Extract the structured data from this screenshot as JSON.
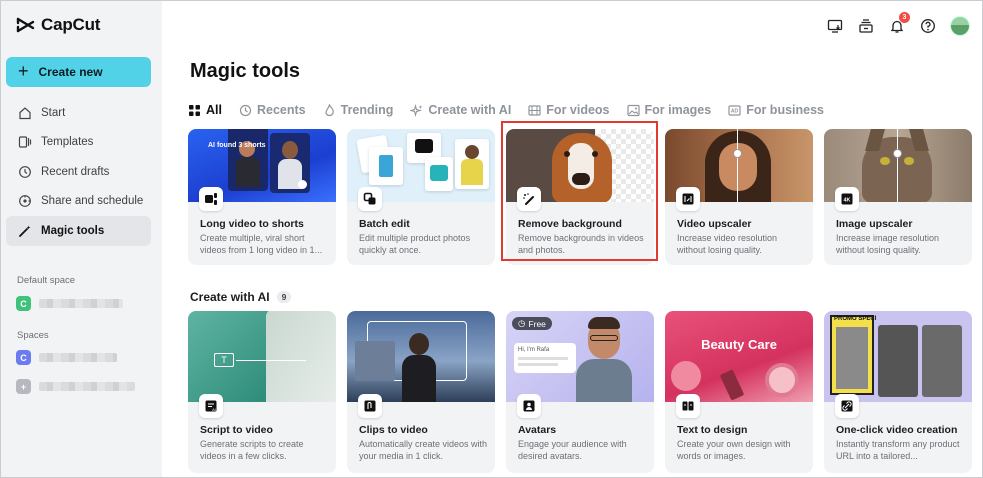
{
  "app": {
    "name": "CapCut"
  },
  "sidebar": {
    "create_label": "Create new",
    "items": [
      {
        "label": "Start",
        "icon": "home-icon"
      },
      {
        "label": "Templates",
        "icon": "templates-icon"
      },
      {
        "label": "Recent drafts",
        "icon": "clock-icon"
      },
      {
        "label": "Share and schedule",
        "icon": "share-icon"
      },
      {
        "label": "Magic tools",
        "icon": "magic-wand-icon",
        "active": true
      }
    ],
    "default_space_label": "Default space",
    "spaces_label": "Spaces",
    "default_space_initial": "C",
    "spaces": [
      {
        "initial": "C",
        "color": "#6c7cf0"
      },
      {
        "initial": "+",
        "color": "#b5b9bf"
      }
    ],
    "default_space_color": "#40c27a"
  },
  "header": {
    "notification_count": "3"
  },
  "page": {
    "title": "Magic tools"
  },
  "tabs": [
    {
      "label": "All",
      "icon": "grid-icon",
      "active": true
    },
    {
      "label": "Recents",
      "icon": "clock-icon"
    },
    {
      "label": "Trending",
      "icon": "flame-icon"
    },
    {
      "label": "Create with AI",
      "icon": "sparkle-icon"
    },
    {
      "label": "For videos",
      "icon": "film-icon"
    },
    {
      "label": "For images",
      "icon": "image-icon"
    },
    {
      "label": "For business",
      "icon": "business-icon"
    }
  ],
  "tools_row1": [
    {
      "title": "Long video to shorts",
      "desc": "Create multiple, viral short videos from 1 long video in 1...",
      "overlay": "AI found 3 shorts"
    },
    {
      "title": "Batch edit",
      "desc": "Edit multiple product photos quickly at once."
    },
    {
      "title": "Remove background",
      "desc": "Remove backgrounds in videos and photos."
    },
    {
      "title": "Video upscaler",
      "desc": "Increase video resolution without losing quality."
    },
    {
      "title": "Image upscaler",
      "desc": "Increase image resolution without losing quality."
    }
  ],
  "create_ai": {
    "title": "Create with AI",
    "count": "9",
    "items": [
      {
        "title": "Script to video",
        "desc": "Generate scripts to create videos in a few clicks."
      },
      {
        "title": "Clips to video",
        "desc": "Automatically create videos with your media in 1 click."
      },
      {
        "title": "Avatars",
        "desc": "Engage your audience with desired avatars.",
        "tag": "Free",
        "bubble": "Hi, I'm Rafa"
      },
      {
        "title": "Text to design",
        "desc": "Create your own design with words or images.",
        "overlay": "Beauty Care"
      },
      {
        "title": "One-click video creation",
        "desc": "Instantly transform any product URL into a tailored...",
        "overlay": "PROMO SPECI"
      }
    ]
  },
  "colors": {
    "accent": "#52d2e6",
    "highlight": "#e23a32",
    "sidebar_bg": "#f2f3f5"
  }
}
